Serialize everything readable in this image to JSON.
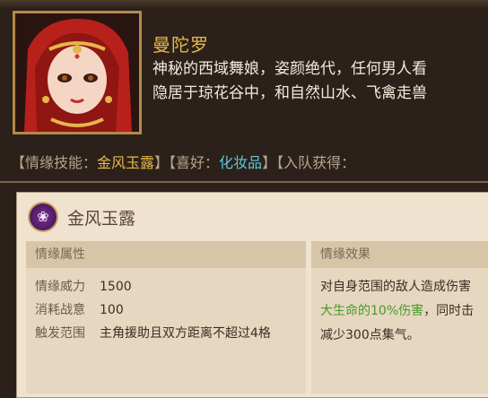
{
  "character": {
    "name": "曼陀罗",
    "bio_line1": "神秘的西域舞娘，姿颜绝代，任何男人看",
    "bio_line2": "隐居于琼花谷中，和自然山水、飞禽走兽"
  },
  "info": {
    "skill_label": "【情缘技能：",
    "skill_value": "金风玉露",
    "hobby_label": "】【喜好：",
    "hobby_value": "化妆品",
    "join_label": "】【入队获得："
  },
  "skill": {
    "icon": "lotus-icon",
    "title": "金风玉露",
    "attributes_header": "情缘属性",
    "effect_header": "情缘效果",
    "attributes": [
      {
        "label": "情缘威力",
        "value": "1500"
      },
      {
        "label": "消耗战意",
        "value": "100"
      },
      {
        "label": "触发范围",
        "value": "主角援助且双方距离不超过4格"
      }
    ],
    "effect_line1": "对自身范围的敌人造成伤害",
    "effect_line2_green": "大生命的10%伤害",
    "effect_line2_rest": "，同时击",
    "effect_line3": "减少300点集气。"
  },
  "colors": {
    "gold": "#e7b84a",
    "cyan": "#5cc7d8",
    "green": "#4a9a2a",
    "background": "#2b211a",
    "panel": "#efe3cf"
  }
}
